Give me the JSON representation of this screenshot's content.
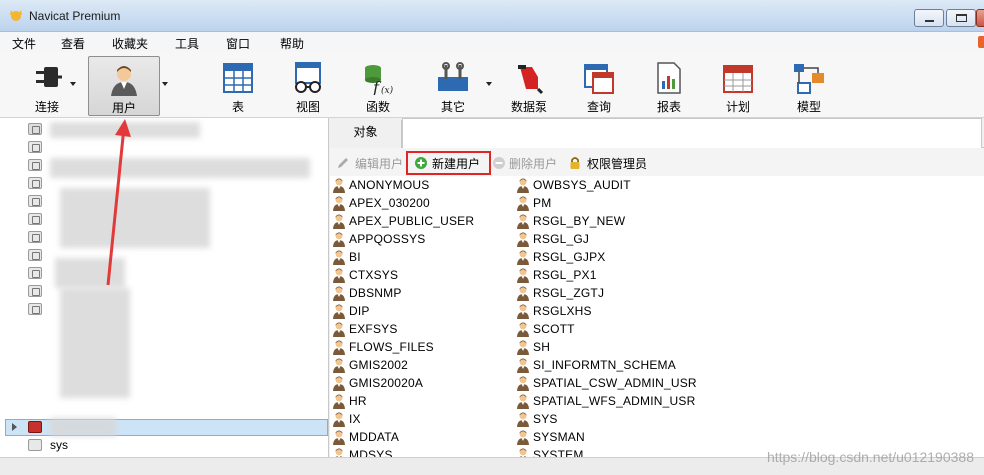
{
  "window": {
    "title": "Navicat Premium"
  },
  "menu": [
    "文件",
    "查看",
    "收藏夹",
    "工具",
    "窗口",
    "帮助"
  ],
  "toolbar": {
    "connect": "连接",
    "user": "用户",
    "table": "表",
    "view": "视图",
    "function": "函数",
    "other": "其它",
    "datapump": "数据泵",
    "query": "查询",
    "report": "报表",
    "schedule": "计划",
    "model": "模型"
  },
  "tree": {
    "sys_label": "sys"
  },
  "tabs": {
    "objects": "对象"
  },
  "actions": {
    "edit_user": "编辑用户",
    "new_user": "新建用户",
    "delete_user": "删除用户",
    "privilege_manager": "权限管理员"
  },
  "users_col1": [
    "ANONYMOUS",
    "APEX_030200",
    "APEX_PUBLIC_USER",
    "APPQOSSYS",
    "BI",
    "CTXSYS",
    "DBSNMP",
    "DIP",
    "EXFSYS",
    "FLOWS_FILES",
    "GMIS2002",
    "GMIS20020A",
    "HR",
    "IX",
    "MDDATA",
    "MDSYS"
  ],
  "users_col2": [
    "OWBSYS_AUDIT",
    "PM",
    "RSGL_BY_NEW",
    "RSGL_GJ",
    "RSGL_GJPX",
    "RSGL_PX1",
    "RSGL_ZGTJ",
    "RSGLXHS",
    "SCOTT",
    "SH",
    "SI_INFORMTN_SCHEMA",
    "SPATIAL_CSW_ADMIN_USR",
    "SPATIAL_WFS_ADMIN_USR",
    "SYS",
    "SYSMAN",
    "SYSTEM"
  ],
  "watermark": "https://blog.csdn.net/u012190388",
  "colors": {
    "highlight": "#e02525",
    "selection": "#cde4f7"
  },
  "icons": {
    "connect": "plug-icon",
    "user": "user-icon",
    "table": "table-icon",
    "view": "glasses-icon",
    "function": "function-icon",
    "other": "tools-icon",
    "datapump": "pump-icon",
    "query": "query-icon",
    "report": "report-icon",
    "schedule": "calendar-icon",
    "model": "model-icon"
  }
}
